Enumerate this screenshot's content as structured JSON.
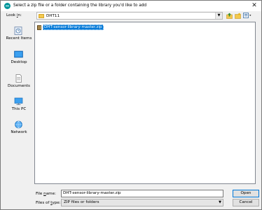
{
  "window": {
    "title": "Select a zip file or a folder containing the library you'd like to add",
    "close_symbol": "✕"
  },
  "lookin": {
    "label_pre": "Look ",
    "label_key": "i",
    "label_post": "n:",
    "value": "DHT11"
  },
  "places": [
    {
      "label": "Recent Items",
      "icon": "recent-items-icon"
    },
    {
      "label": "Desktop",
      "icon": "desktop-icon"
    },
    {
      "label": "Documents",
      "icon": "documents-icon"
    },
    {
      "label": "This PC",
      "icon": "this-pc-icon"
    },
    {
      "label": "Network",
      "icon": "network-icon"
    }
  ],
  "files": [
    {
      "name": "DHT-sensor-library-master.zip",
      "selected": true
    }
  ],
  "filename": {
    "label_pre": "File ",
    "label_key": "n",
    "label_post": "ame:",
    "value": "DHT-sensor-library-master.zip"
  },
  "filetype": {
    "label_pre": "Files of ",
    "label_key": "t",
    "label_post": "ype:",
    "value": "ZIP files or folders"
  },
  "buttons": {
    "open": "Open",
    "cancel": "Cancel"
  }
}
